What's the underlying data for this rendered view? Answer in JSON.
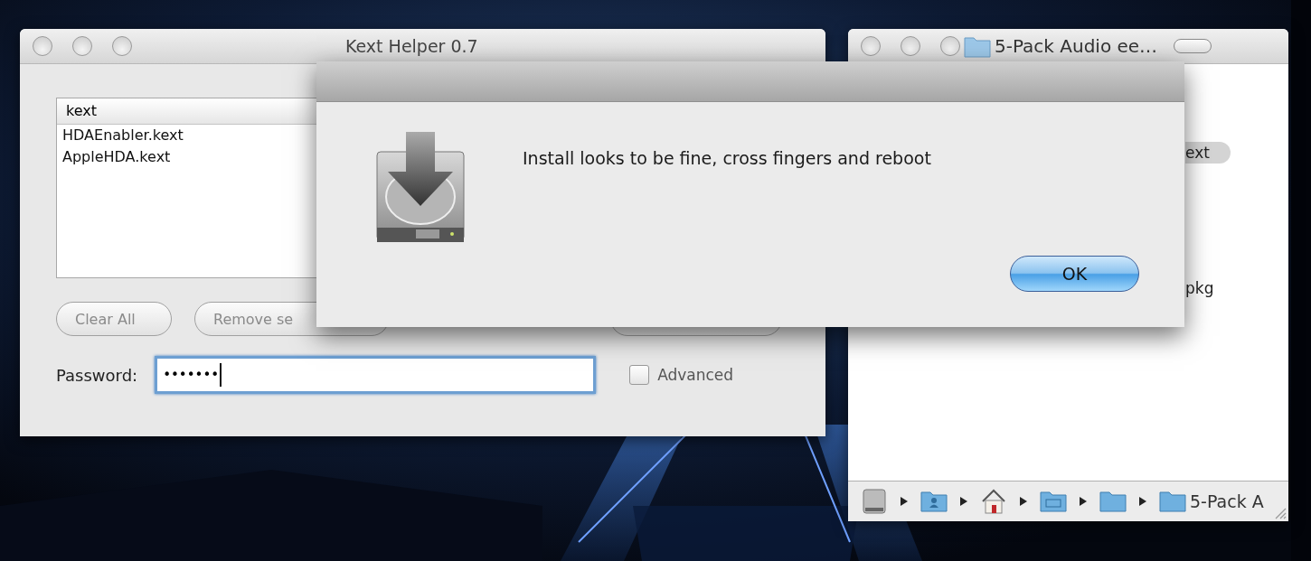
{
  "kext_window": {
    "title": "Kext Helper 0.7",
    "list": {
      "header": "kext",
      "items": [
        "HDAEnabler.kext",
        "AppleHDA.kext"
      ]
    },
    "buttons": [
      {
        "label": "Clear All"
      },
      {
        "label": "Remove se"
      }
    ],
    "password": {
      "label": "Password:",
      "value": "•••••••",
      "focused": true
    },
    "advanced": {
      "label": "Advanced",
      "checked": false
    }
  },
  "finder_window": {
    "title": "5-Pack Audio ee…",
    "items": [
      {
        "text": "ext",
        "selected": true
      },
      {
        "text": "pkg",
        "selected": false
      }
    ],
    "path_bar": [
      {
        "kind": "disk"
      },
      {
        "kind": "user"
      },
      {
        "kind": "home"
      },
      {
        "kind": "docs"
      },
      {
        "kind": "folder"
      },
      {
        "kind": "folder",
        "label": "5-Pack A"
      }
    ]
  },
  "dialog": {
    "message": "Install looks to be fine, cross fingers and reboot",
    "button": {
      "label": "OK",
      "default": true
    }
  }
}
